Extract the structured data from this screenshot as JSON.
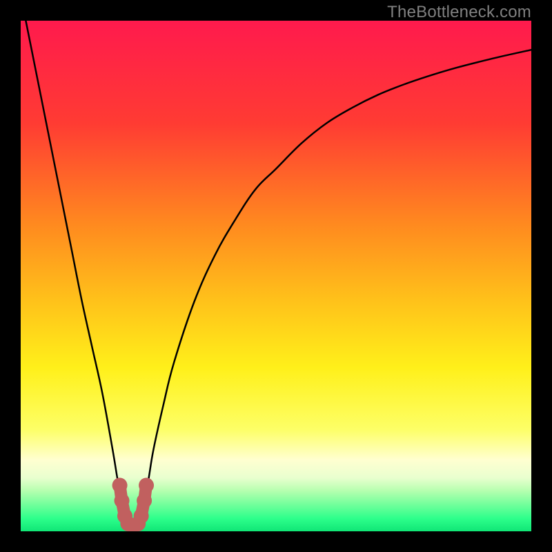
{
  "watermark": "TheBottleneck.com",
  "chart_data": {
    "type": "line",
    "title": "",
    "xlabel": "",
    "ylabel": "",
    "xlim": [
      0,
      100
    ],
    "ylim": [
      0,
      100
    ],
    "grid": false,
    "legend": false,
    "series": [
      {
        "name": "bottleneck-curve",
        "x": [
          0,
          2,
          4,
          6,
          8,
          10,
          12,
          14,
          16,
          18,
          19,
          20,
          21,
          22,
          23,
          24,
          25,
          26,
          28,
          30,
          34,
          38,
          42,
          46,
          50,
          55,
          60,
          65,
          70,
          75,
          80,
          85,
          90,
          95,
          100
        ],
        "y": [
          105,
          95,
          85,
          75,
          65,
          55,
          45,
          36,
          27,
          16,
          10,
          5,
          2,
          1,
          2,
          5,
          10,
          16,
          25,
          33,
          45,
          54,
          61,
          67,
          71,
          76,
          80,
          83,
          85.5,
          87.5,
          89.2,
          90.7,
          92,
          93.2,
          94.3
        ]
      }
    ],
    "highlight": {
      "name": "valley-marker",
      "color": "#c1605f",
      "points": [
        {
          "x": 19.4,
          "y": 9.0
        },
        {
          "x": 19.8,
          "y": 6.0
        },
        {
          "x": 20.4,
          "y": 3.0
        },
        {
          "x": 21.0,
          "y": 1.5
        },
        {
          "x": 22.0,
          "y": 1.0
        },
        {
          "x": 23.0,
          "y": 1.5
        },
        {
          "x": 23.6,
          "y": 3.0
        },
        {
          "x": 24.2,
          "y": 6.0
        },
        {
          "x": 24.6,
          "y": 9.0
        }
      ]
    },
    "background_gradient": {
      "stops": [
        {
          "pos": 0.0,
          "color": "#ff1a4d"
        },
        {
          "pos": 0.2,
          "color": "#ff3b33"
        },
        {
          "pos": 0.4,
          "color": "#ff8a1f"
        },
        {
          "pos": 0.55,
          "color": "#ffc21a"
        },
        {
          "pos": 0.68,
          "color": "#fff01a"
        },
        {
          "pos": 0.8,
          "color": "#fdff66"
        },
        {
          "pos": 0.86,
          "color": "#ffffd0"
        },
        {
          "pos": 0.895,
          "color": "#e9ffcf"
        },
        {
          "pos": 0.92,
          "color": "#b7ffb0"
        },
        {
          "pos": 0.95,
          "color": "#6cff9a"
        },
        {
          "pos": 0.975,
          "color": "#2dff8b"
        },
        {
          "pos": 1.0,
          "color": "#10e676"
        }
      ]
    }
  }
}
